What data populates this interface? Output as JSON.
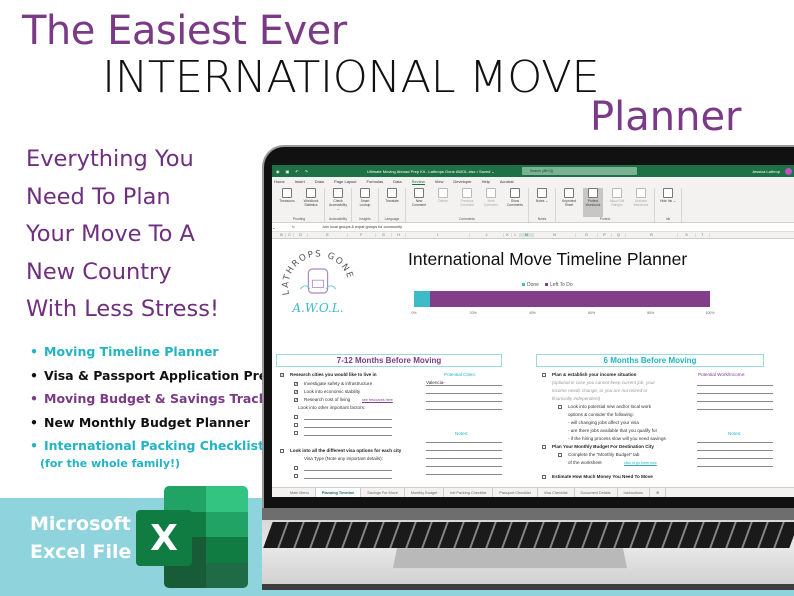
{
  "headline": {
    "line1": "The Easiest Ever",
    "line2": "INTERNATIONAL MOVE",
    "line3": "Planner"
  },
  "tagline": [
    "Everything You",
    "Need To Plan",
    "Your Move To A",
    "New Country",
    "With Less Stress!"
  ],
  "features": [
    {
      "label": "Moving Timeline Planner",
      "color": "teal"
    },
    {
      "label": "Visa & Passport Application Prep",
      "color": "black"
    },
    {
      "label": "Moving Budget & Savings Tracker",
      "color": "purple"
    },
    {
      "label": "New Monthly Budget Planner",
      "color": "black"
    },
    {
      "label": "International Packing Checklist",
      "color": "teal"
    }
  ],
  "features_note": "(for the whole family!)",
  "badge": {
    "line1": "Microsoft",
    "line2": "Excel File",
    "logo_letter": "X"
  },
  "colors": {
    "purple": "#7b3a86",
    "teal": "#22b4c4",
    "excel_green": "#1e7145",
    "band": "#8fd3dd",
    "done": "#3dbcc8",
    "left_to_do": "#833e8a"
  },
  "excel": {
    "title": "Ultimate Moving Abroad Prep Kit - Lathrops Gone AWOL.xlsx • Saved ⌄",
    "search_placeholder": "Search (Alt+Q)",
    "user": "Jessica Lathrop",
    "menu": [
      "Home",
      "Insert",
      "Draw",
      "Page Layout",
      "Formulas",
      "Data",
      "Review",
      "View",
      "Developer",
      "Help",
      "Acrobat"
    ],
    "active_menu": "Review",
    "ribbon_groups": [
      {
        "label": "Proofing",
        "buttons": [
          {
            "label": "Thesaurus",
            "state": "normal"
          },
          {
            "label": "Workbook Statistics",
            "state": "normal"
          }
        ]
      },
      {
        "label": "Accessibility",
        "buttons": [
          {
            "label": "Check Accessibility ⌄",
            "state": "normal"
          }
        ]
      },
      {
        "label": "Insights",
        "buttons": [
          {
            "label": "Smart Lookup",
            "state": "normal"
          }
        ]
      },
      {
        "label": "Language",
        "buttons": [
          {
            "label": "Translate",
            "state": "normal"
          }
        ]
      },
      {
        "label": "Comments",
        "buttons": [
          {
            "label": "New Comment",
            "state": "normal"
          },
          {
            "label": "Delete",
            "state": "dim"
          },
          {
            "label": "Previous Comment",
            "state": "dim"
          },
          {
            "label": "Next Comment",
            "state": "dim"
          },
          {
            "label": "Show Comments",
            "state": "normal"
          }
        ]
      },
      {
        "label": "Notes",
        "buttons": [
          {
            "label": "Notes ⌄",
            "state": "normal"
          }
        ]
      },
      {
        "label": "Protect",
        "buttons": [
          {
            "label": "Unprotect Sheet",
            "state": "normal"
          },
          {
            "label": "Protect Workbook",
            "state": "sel"
          },
          {
            "label": "Allow Edit Ranges",
            "state": "dim"
          },
          {
            "label": "Unshare Workbook",
            "state": "dim"
          }
        ]
      },
      {
        "label": "Ink",
        "buttons": [
          {
            "label": "Hide Ink ⌄",
            "state": "normal"
          }
        ]
      }
    ],
    "formula_bar": {
      "fx": "fx",
      "value": "Join local groups & expat groups for community"
    },
    "columns": [
      "B",
      "C",
      "D",
      "E",
      "F",
      "G",
      "H",
      "I",
      "J",
      "K",
      "L",
      "M",
      "N",
      "O",
      "P",
      "Q",
      "R",
      "S",
      "T"
    ],
    "selected_column": "M",
    "logo_text": {
      "arc": "LATHROPS GONE",
      "sub": "A.W.O.L."
    },
    "sheet_title": "International Move Timeline Planner",
    "sections": {
      "left": "7-12 Months Before Moving",
      "right": "6 Months Before Moving"
    },
    "left_tasks": {
      "main1": "Research cities you would like to live in",
      "sub1": "Investigate safety & infrastructure",
      "sub2": "Look into economic stability",
      "sub3": "Research cost of living",
      "sub3_link": "see resources here",
      "sub4": "Look into other important factors:",
      "main2": "Look into all the different visa options for each city",
      "sub5": "Visa Type (Note any important details):",
      "cities_header": "Potential Cities:",
      "city1": "Valencia-",
      "notes_header": "Notes:"
    },
    "right_tasks": {
      "main1": "Plan & establish your income situation",
      "note1": "(optional in case you cannot keep current job, your",
      "note2": "income needs change, or you are not retired or",
      "note3": "financially independent)",
      "sub1a": "Look into potential new and/or local work",
      "sub1b": "options & consider the following:",
      "bul1": "- will changing jobs affect your visa",
      "bul2": "- are there jobs available that you qualify for",
      "bul3": "- if the hiring process slow will you need savings",
      "main2": "Plan Your Monthly Budget For Destination City",
      "sub2a": "Complete the \"Monthly Budget\" tab",
      "sub2b": "of the worksheet",
      "sub2_link": "click to go there now",
      "main3": "Estimate How Much Money You Need To Move",
      "work_header": "Potential Work/Income:",
      "notes_header": "Notes:"
    },
    "sheet_tabs": [
      "Main Menu",
      "Planning Timeline",
      "Savings For Move",
      "Monthly Budget",
      "Intl Packing Checklist",
      "Passport Checklist",
      "Visa Checklist",
      "Document Details",
      "Instructions"
    ],
    "active_tab": "Planning Timeline"
  },
  "chart_data": {
    "type": "bar",
    "orientation": "horizontal-stacked",
    "title": "International Move Timeline Planner",
    "categories": [
      "Progress"
    ],
    "series": [
      {
        "name": "Done",
        "values": [
          5.5
        ],
        "color": "#3dbcc8"
      },
      {
        "name": "Left To Do",
        "values": [
          94.5
        ],
        "color": "#833e8a"
      }
    ],
    "xlim": [
      0,
      100
    ],
    "xticks": [
      "0%",
      "20%",
      "40%",
      "60%",
      "80%",
      "100%"
    ],
    "legend": "top-center",
    "grid": false
  }
}
